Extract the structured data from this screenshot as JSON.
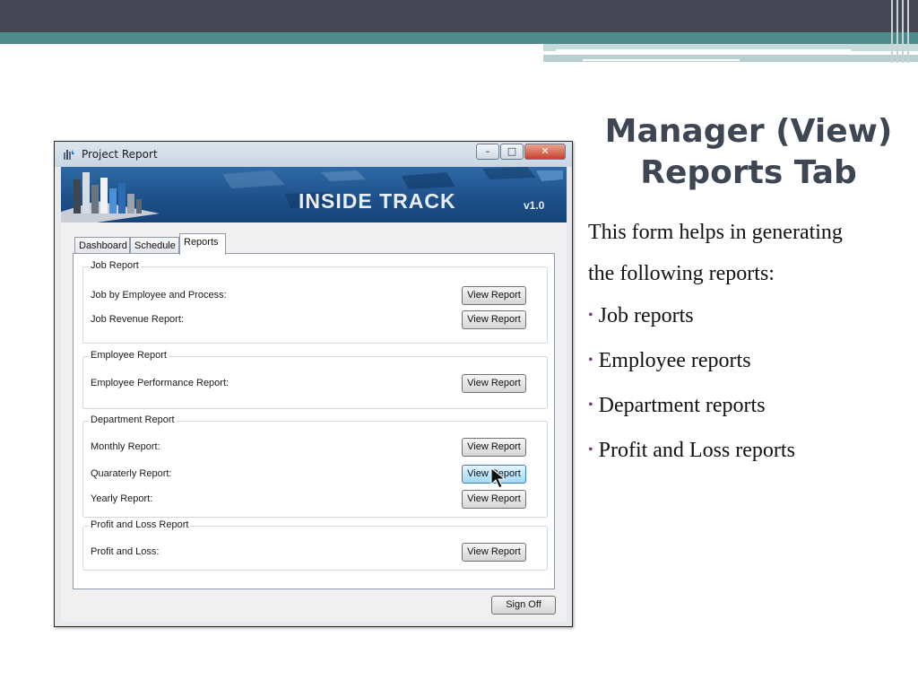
{
  "slide": {
    "title_line1": "Manager (View)",
    "title_line2": "Reports Tab",
    "intro_line1": "This form helps  in generating",
    "intro_line2": "the following reports:",
    "bullets": [
      "Job reports",
      "Employee reports",
      "Department reports",
      "Profit and Loss reports"
    ],
    "accent_colors": {
      "header_dark": "#454653",
      "header_teal": "#4e8a8a",
      "bullet": "#7a3a7a"
    }
  },
  "window": {
    "title": "Project Report",
    "controls": {
      "minimize": "–",
      "maximize": "□",
      "close": "✕"
    },
    "banner": {
      "brand": "INSIDE TRACK",
      "version": "v1.0"
    },
    "tabs": [
      "Dashboard",
      "Schedule",
      "Reports"
    ],
    "active_tab": "Reports",
    "groups": [
      {
        "title": "Job Report",
        "rows": [
          {
            "label": "Job by Employee and Process:",
            "button": "View Report"
          },
          {
            "label": "Job Revenue Report:",
            "button": "View Report"
          }
        ]
      },
      {
        "title": "Employee Report",
        "rows": [
          {
            "label": "Employee Performance Report:",
            "button": "View Report"
          }
        ]
      },
      {
        "title": "Department Report",
        "rows": [
          {
            "label": "Monthly Report:",
            "button": "View Report"
          },
          {
            "label": "Quaraterly Report:",
            "button": "View Report"
          },
          {
            "label": "Yearly Report:",
            "button": "View Report"
          }
        ]
      },
      {
        "title": "Profit and Loss Report",
        "rows": [
          {
            "label": "Profit and Loss:",
            "button": "View Report"
          }
        ]
      }
    ],
    "sign_off": "Sign Off"
  }
}
